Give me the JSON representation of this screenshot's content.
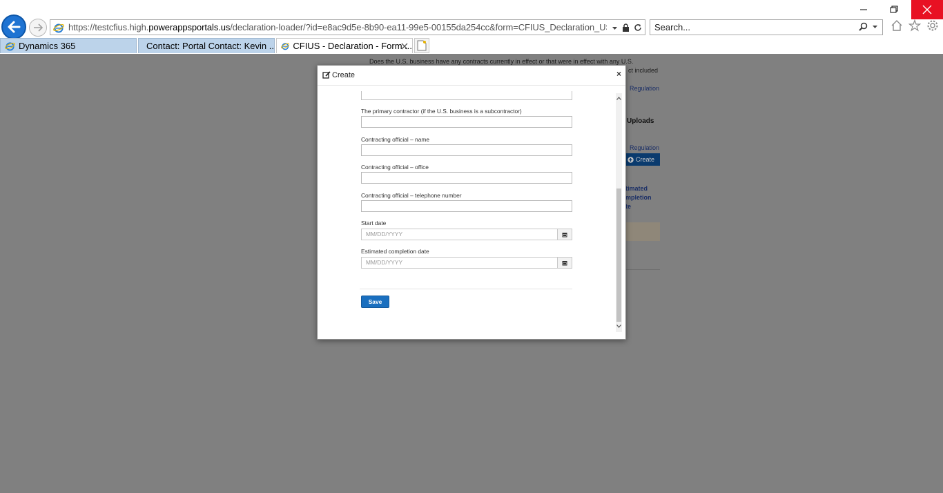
{
  "browser": {
    "url_prefix": "https://testcfius.high.",
    "url_host": "powerappsportals.us",
    "url_rest": "/declaration-loader/?id=e8ac9d5e-8b90-ea11-99e5-00155da254cc&form=CFIUS_Declaration_US_Business",
    "search_placeholder": "Search...",
    "tabs": [
      {
        "label": "Dynamics 365"
      },
      {
        "label": "Contact: Portal Contact: Kevin ..."
      },
      {
        "label": "CFIUS - Declaration - Form ..."
      }
    ]
  },
  "background_page": {
    "question_line1": "Does the U.S. business have any contracts currently in effect or that were in effect with any U.S.",
    "question_line2_fragment": "ct included",
    "regulation_link_1": "Regulation",
    "uploads_heading": "Uploads",
    "regulation_link_2": "Regulation",
    "create_button": "Create",
    "column_header_line1": "timated",
    "column_header_line2": "mpletion",
    "column_header_line3": "te"
  },
  "modal": {
    "title": "Create",
    "close_symbol": "×",
    "fields": {
      "primary_contractor_label": "The primary contractor (if the U.S. business is a subcontractor)",
      "official_name_label": "Contracting official – name",
      "official_office_label": "Contracting official – office",
      "official_phone_label": "Contracting official – telephone number",
      "start_date_label": "Start date",
      "start_date_placeholder": "MM/DD/YYYY",
      "completion_date_label": "Estimated completion date",
      "completion_date_placeholder": "MM/DD/YYYY"
    },
    "save_label": "Save"
  },
  "colors": {
    "accent": "#1a6fbf",
    "close_red": "#e81123",
    "back_blue": "#1e73d2",
    "overlay": "#808080"
  }
}
